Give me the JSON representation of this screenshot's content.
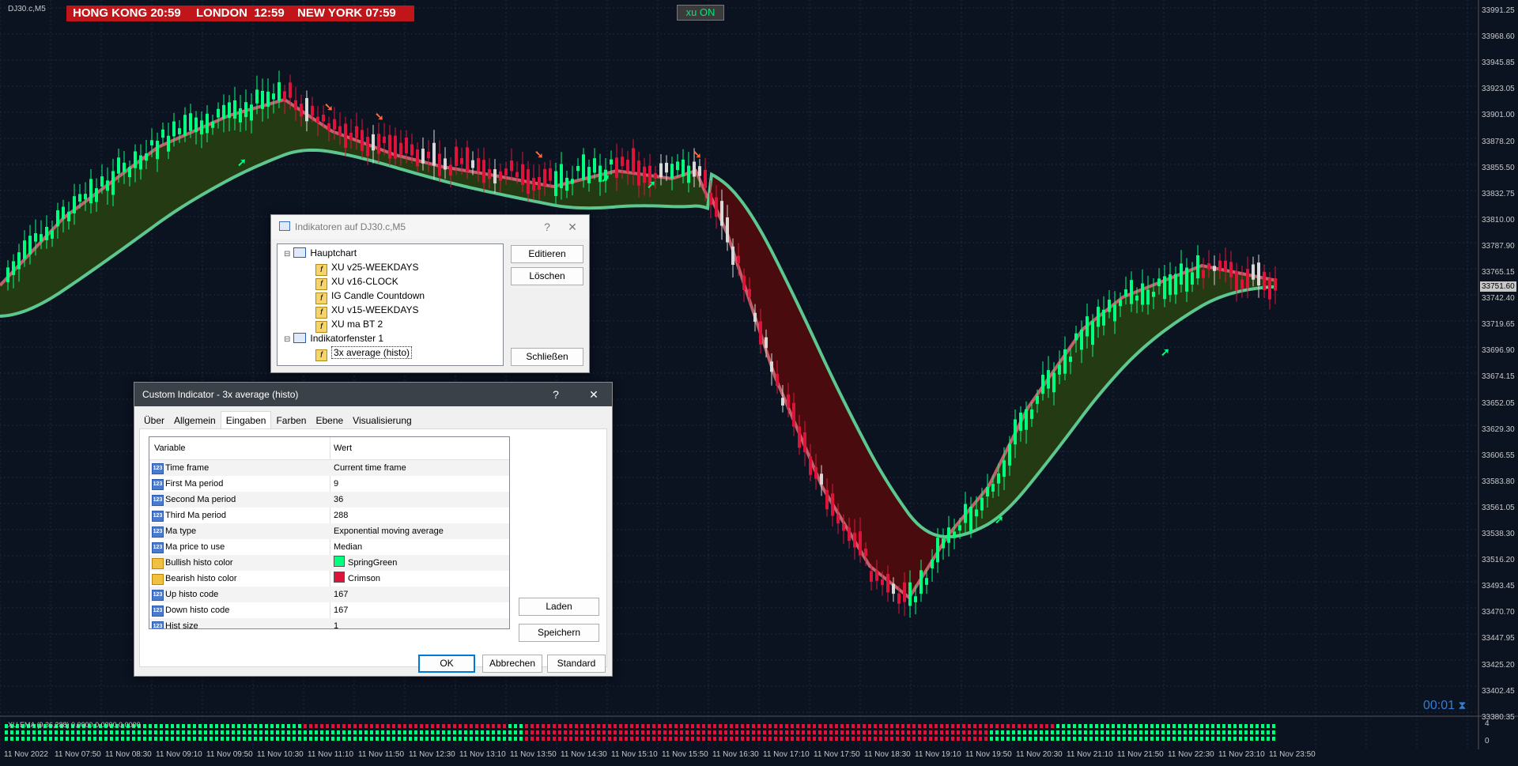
{
  "chart": {
    "symbol": "DJ30.c,M5",
    "clocks": [
      {
        "city": "HONG KONG",
        "time": "20:59"
      },
      {
        "city": "LONDON",
        "time": "12:59"
      },
      {
        "city": "NEW YORK",
        "time": "07:59"
      }
    ],
    "xu_button": "xu ON",
    "price_label": "33751.60",
    "countdown": "00:01",
    "subwindow_label": "XU EMA (9,36,288) 0.0000 0.0000 0.0000",
    "subwindow_scale": [
      "4",
      "0"
    ],
    "y_axis": [
      "33991.25",
      "33968.60",
      "33945.85",
      "33923.05",
      "33901.00",
      "33878.20",
      "33855.50",
      "33832.75",
      "33810.00",
      "33787.90",
      "33765.15",
      "33742.40",
      "33719.65",
      "33696.90",
      "33674.15",
      "33652.05",
      "33629.30",
      "33606.55",
      "33583.80",
      "33561.05",
      "33538.30",
      "33516.20",
      "33493.45",
      "33470.70",
      "33447.95",
      "33425.20",
      "33402.45",
      "33380.35"
    ],
    "x_axis": [
      "11 Nov 2022",
      "11 Nov 07:50",
      "11 Nov 08:30",
      "11 Nov 09:10",
      "11 Nov 09:50",
      "11 Nov 10:30",
      "11 Nov 11:10",
      "11 Nov 11:50",
      "11 Nov 12:30",
      "11 Nov 13:10",
      "11 Nov 13:50",
      "11 Nov 14:30",
      "11 Nov 15:10",
      "11 Nov 15:50",
      "11 Nov 16:30",
      "11 Nov 17:10",
      "11 Nov 17:50",
      "11 Nov 18:30",
      "11 Nov 19:10",
      "11 Nov 19:50",
      "11 Nov 20:30",
      "11 Nov 21:10",
      "11 Nov 21:50",
      "11 Nov 22:30",
      "11 Nov 23:10",
      "11 Nov 23:50"
    ],
    "colors": {
      "bull": "#00ff7f",
      "bear": "#dc143c",
      "background": "#0b1220"
    }
  },
  "indicators_dialog": {
    "title": "Indikatoren auf DJ30.c,M5",
    "help": "?",
    "close": "✕",
    "tree": [
      {
        "label": "Hauptchart",
        "level": 0,
        "type": "folder"
      },
      {
        "label": "XU v25-WEEKDAYS",
        "level": 1,
        "type": "item"
      },
      {
        "label": "XU v16-CLOCK",
        "level": 1,
        "type": "item"
      },
      {
        "label": "IG Candle Countdown",
        "level": 1,
        "type": "item"
      },
      {
        "label": "XU v15-WEEKDAYS",
        "level": 1,
        "type": "item"
      },
      {
        "label": "XU ma BT 2",
        "level": 1,
        "type": "item"
      },
      {
        "label": "Indikatorfenster 1",
        "level": 0,
        "type": "folder"
      },
      {
        "label": "3x average (histo)",
        "level": 1,
        "type": "item"
      }
    ],
    "buttons": {
      "edit": "Editieren",
      "delete": "Löschen",
      "close": "Schließen"
    }
  },
  "custom_dialog": {
    "title": "Custom Indicator - 3x average (histo)",
    "help": "?",
    "close": "✕",
    "tabs": [
      "Über",
      "Allgemein",
      "Eingaben",
      "Farben",
      "Ebene",
      "Visualisierung"
    ],
    "active_tab": "Eingaben",
    "columns": {
      "variable": "Variable",
      "value": "Wert"
    },
    "rows": [
      {
        "variable": "Time frame",
        "value": "Current time frame",
        "icon": "123"
      },
      {
        "variable": "First Ma period",
        "value": "9",
        "icon": "123"
      },
      {
        "variable": "Second Ma period",
        "value": "36",
        "icon": "123"
      },
      {
        "variable": "Third Ma period",
        "value": "288",
        "icon": "123"
      },
      {
        "variable": "Ma type",
        "value": "Exponential moving average",
        "icon": "123"
      },
      {
        "variable": "Ma price to use",
        "value": "Median",
        "icon": "123"
      },
      {
        "variable": "Bullish histo  color",
        "value": "SpringGreen",
        "icon": "color",
        "swatch": "#00ff7f"
      },
      {
        "variable": "Bearish histo  color",
        "value": "Crimson",
        "icon": "color",
        "swatch": "#dc143c"
      },
      {
        "variable": "Up histo code",
        "value": "167",
        "icon": "123"
      },
      {
        "variable": "Down histo code",
        "value": "167",
        "icon": "123"
      },
      {
        "variable": "Hist size",
        "value": "1",
        "icon": "123"
      }
    ],
    "buttons": {
      "load": "Laden",
      "save": "Speichern",
      "ok": "OK",
      "cancel": "Abbrechen",
      "default": "Standard"
    }
  }
}
